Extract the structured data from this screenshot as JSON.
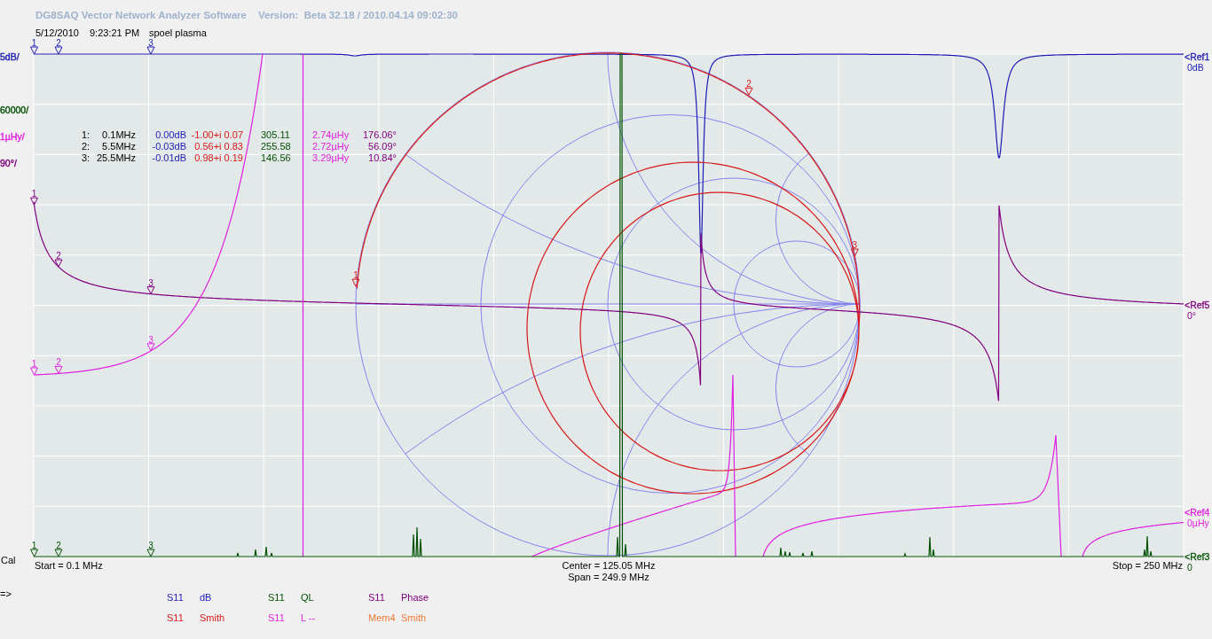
{
  "title": "DG8SAQ Vector Network Analyzer Software",
  "version": "Version:  Beta 32.18 / 2010.04.14 09:02:30",
  "header": {
    "date": "5/12/2010",
    "time": "9:23:21 PM",
    "measurement": "spoel plasma"
  },
  "axis_labels": [
    {
      "text": "5dB/",
      "color": "#1c1cb4"
    },
    {
      "text": "60000/",
      "color": "#005000"
    },
    {
      "text": "1µHy/",
      "color": "#e020e0"
    },
    {
      "text": "90°/",
      "color": "#800080"
    }
  ],
  "references": [
    {
      "label": "<Ref1",
      "value": "0dB",
      "color": "#1c1cb4"
    },
    {
      "label": "<Ref5",
      "value": "0°",
      "color": "#800080"
    },
    {
      "label": "<Ref4",
      "value": "0µHy",
      "color": "#e020e0"
    },
    {
      "label": "<Ref3",
      "value": "0",
      "color": "#005000"
    }
  ],
  "traces": [
    {
      "kind": "magnitude",
      "color": "#1c1cb4",
      "markers": [
        "1",
        "2",
        "3"
      ]
    },
    {
      "kind": "smith",
      "color": "#d81818",
      "markers": [
        "1",
        "2",
        "3"
      ]
    },
    {
      "kind": "phase",
      "color": "#800080",
      "markers": [
        "1",
        "2",
        "3"
      ]
    },
    {
      "kind": "inductance",
      "color": "#e020e0",
      "markers": [
        "1",
        "2",
        "3"
      ]
    },
    {
      "kind": "ql",
      "color": "#005000",
      "markers": [
        "1",
        "2",
        "3"
      ]
    }
  ],
  "marker_table": [
    {
      "index": "1:",
      "frequency": "0.1MHz",
      "values": [
        "0.00dB",
        "-1.00+i 0.07",
        "305.11",
        "2.74µHy",
        "176.06°"
      ]
    },
    {
      "index": "2:",
      "frequency": "5.5MHz",
      "values": [
        "-0.03dB",
        "0.56+i 0.83",
        "255.58",
        "2.72µHy",
        "56.09°"
      ]
    },
    {
      "index": "3:",
      "frequency": "25.5MHz",
      "values": [
        "-0.01dB",
        "0.98+i 0.19",
        "146.56",
        "3.29µHy",
        "10.84°"
      ]
    }
  ],
  "status": {
    "calibration": "Cal",
    "start": "Start = 0.1 MHz",
    "center": "Center = 125.05 MHz",
    "span": "Span = 249.9 MHz",
    "stop": "Stop = 250 MHz"
  },
  "prompt": "=>",
  "legend": [
    {
      "parameter": "S11",
      "format": "dB",
      "color": "#1c1cb4"
    },
    {
      "parameter": "S11",
      "format": "QL",
      "color": "#005000"
    },
    {
      "parameter": "S11",
      "format": "Phase",
      "color": "#800080"
    },
    {
      "parameter": "S11",
      "format": "Smith",
      "color": "#d81818"
    },
    {
      "parameter": "S11",
      "format": "L --",
      "color": "#e020e0"
    },
    {
      "parameter": "Mem4",
      "format": "Smith",
      "color": "#f07838"
    }
  ]
}
